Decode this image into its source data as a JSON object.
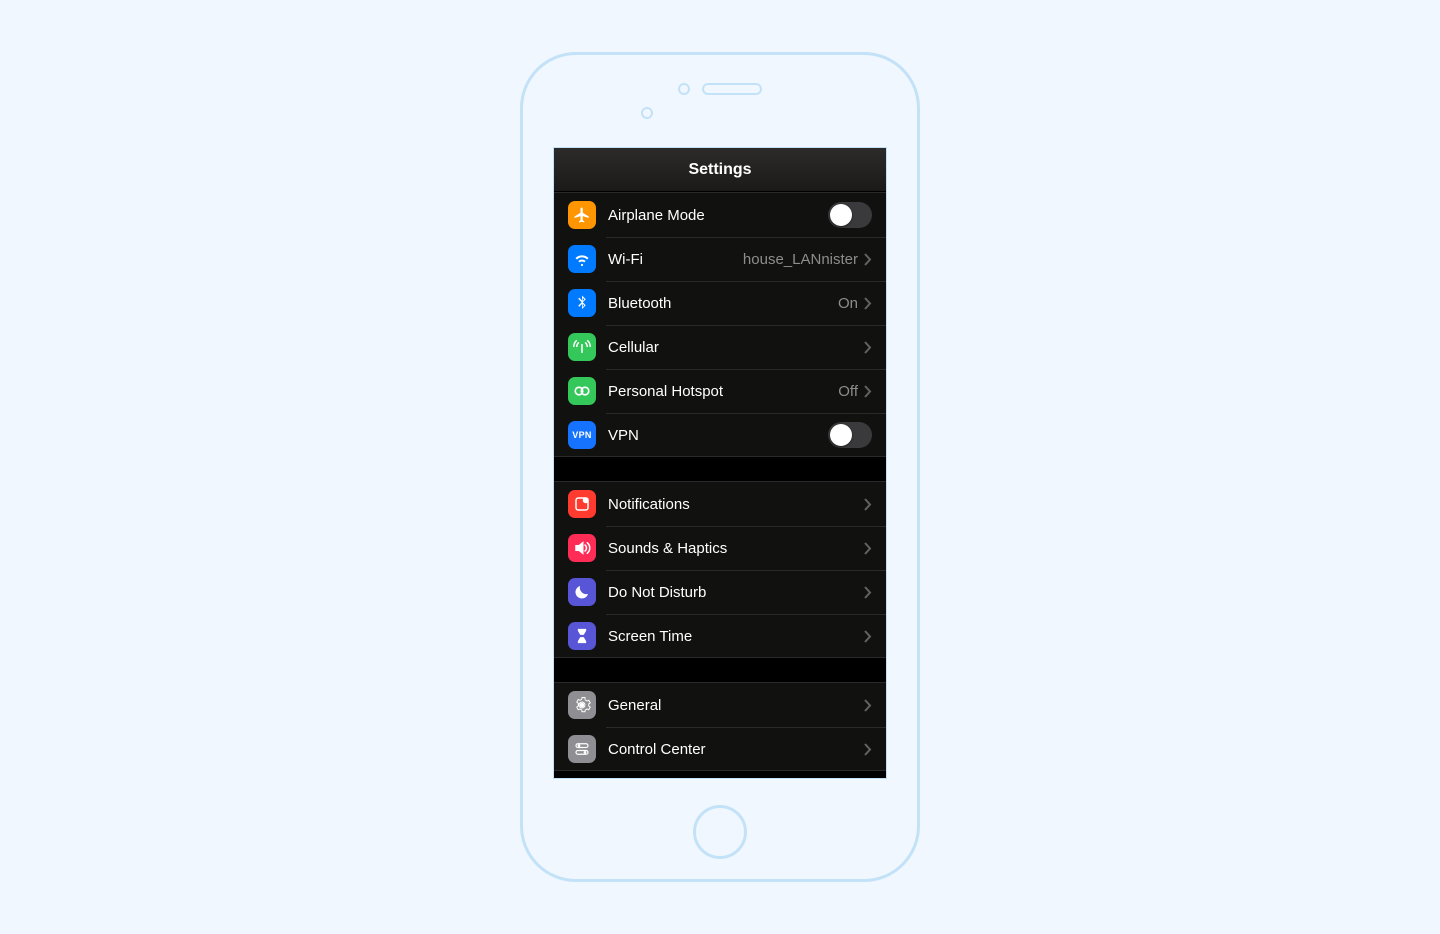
{
  "header": {
    "title": "Settings"
  },
  "groups": [
    {
      "rows": [
        {
          "icon": "airplane-icon",
          "label": "Airplane Mode",
          "control": "toggle",
          "toggle_on": false
        },
        {
          "icon": "wifi-icon",
          "label": "Wi-Fi",
          "control": "nav",
          "value": "house_LANnister"
        },
        {
          "icon": "bluetooth-icon",
          "label": "Bluetooth",
          "control": "nav",
          "value": "On"
        },
        {
          "icon": "cellular-icon",
          "label": "Cellular",
          "control": "nav",
          "value": ""
        },
        {
          "icon": "hotspot-icon",
          "label": "Personal Hotspot",
          "control": "nav",
          "value": "Off"
        },
        {
          "icon": "vpn-icon",
          "label": "VPN",
          "control": "toggle",
          "toggle_on": false
        }
      ]
    },
    {
      "rows": [
        {
          "icon": "notifications-icon",
          "label": "Notifications",
          "control": "nav",
          "value": ""
        },
        {
          "icon": "sounds-icon",
          "label": "Sounds & Haptics",
          "control": "nav",
          "value": ""
        },
        {
          "icon": "dnd-icon",
          "label": "Do Not Disturb",
          "control": "nav",
          "value": ""
        },
        {
          "icon": "screentime-icon",
          "label": "Screen Time",
          "control": "nav",
          "value": ""
        }
      ]
    },
    {
      "rows": [
        {
          "icon": "general-icon",
          "label": "General",
          "control": "nav",
          "value": ""
        },
        {
          "icon": "controlcenter-icon",
          "label": "Control Center",
          "control": "nav",
          "value": ""
        }
      ]
    }
  ]
}
